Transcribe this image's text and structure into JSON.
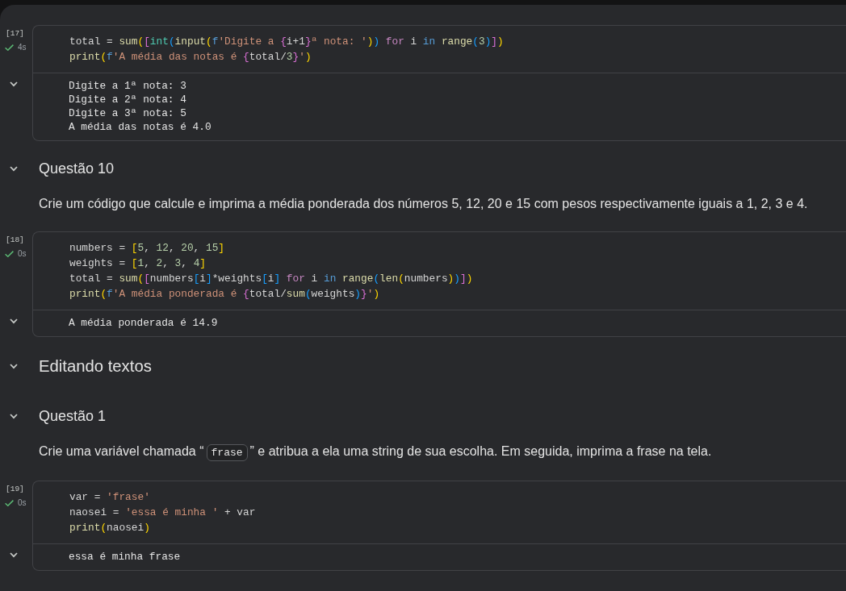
{
  "notebook": {
    "blocks": [
      {
        "kind": "code_cell",
        "execution_count": "[17]",
        "succeeded": true,
        "duration": "4s",
        "code": [
          {
            "tokens": [
              {
                "kind": "plain",
                "text": "total = "
              },
              {
                "kind": "function",
                "text": "sum"
              },
              {
                "kind": "bracket1",
                "text": "("
              },
              {
                "kind": "bracket2",
                "text": "["
              },
              {
                "kind": "builtin_type",
                "text": "int"
              },
              {
                "kind": "bracket3",
                "text": "("
              },
              {
                "kind": "function",
                "text": "input"
              },
              {
                "kind": "bracket1",
                "text": "("
              },
              {
                "kind": "keyword",
                "text": "f"
              },
              {
                "kind": "string",
                "text": "'Digite a "
              },
              {
                "kind": "bracket2",
                "text": "{"
              },
              {
                "kind": "plain",
                "text": "i+1"
              },
              {
                "kind": "bracket2",
                "text": "}"
              },
              {
                "kind": "string",
                "text": "ª nota: '"
              },
              {
                "kind": "bracket1",
                "text": ")"
              },
              {
                "kind": "bracket3",
                "text": ")"
              },
              {
                "kind": "control",
                "text": " for"
              },
              {
                "kind": "plain",
                "text": " i "
              },
              {
                "kind": "keyword",
                "text": "in"
              },
              {
                "kind": "function",
                "text": " range"
              },
              {
                "kind": "bracket3",
                "text": "("
              },
              {
                "kind": "number",
                "text": "3"
              },
              {
                "kind": "bracket3",
                "text": ")"
              },
              {
                "kind": "bracket2",
                "text": "]"
              },
              {
                "kind": "bracket1",
                "text": ")"
              }
            ]
          },
          {
            "tokens": [
              {
                "kind": "function",
                "text": "print"
              },
              {
                "kind": "bracket1",
                "text": "("
              },
              {
                "kind": "keyword",
                "text": "f"
              },
              {
                "kind": "string",
                "text": "'A média das notas é "
              },
              {
                "kind": "bracket2",
                "text": "{"
              },
              {
                "kind": "plain",
                "text": "total/"
              },
              {
                "kind": "number",
                "text": "3"
              },
              {
                "kind": "bracket2",
                "text": "}"
              },
              {
                "kind": "string",
                "text": "'"
              },
              {
                "kind": "bracket1",
                "text": ")"
              }
            ]
          }
        ],
        "output": {
          "expanded": true,
          "lines": [
            "Digite a 1ª nota: 3",
            "Digite a 2ª nota: 4",
            "Digite a 3ª nota: 5",
            "A média das notas é 4.0"
          ]
        }
      },
      {
        "kind": "text_cell",
        "heading": {
          "kind": "h3",
          "text": "Questão 10",
          "expanded": true
        },
        "paragraph": [
          {
            "kind": "text",
            "text": "Crie um código que calcule e imprima a média ponderada dos números 5, 12, 20 e 15 com pesos respectivamente iguais a 1, 2, 3 e 4."
          }
        ]
      },
      {
        "kind": "code_cell",
        "execution_count": "[18]",
        "succeeded": true,
        "duration": "0s",
        "code": [
          {
            "tokens": [
              {
                "kind": "plain",
                "text": "numbers = "
              },
              {
                "kind": "bracket1",
                "text": "["
              },
              {
                "kind": "number",
                "text": "5"
              },
              {
                "kind": "plain",
                "text": ", "
              },
              {
                "kind": "number",
                "text": "12"
              },
              {
                "kind": "plain",
                "text": ", "
              },
              {
                "kind": "number",
                "text": "20"
              },
              {
                "kind": "plain",
                "text": ", "
              },
              {
                "kind": "number",
                "text": "15"
              },
              {
                "kind": "bracket1",
                "text": "]"
              }
            ]
          },
          {
            "tokens": [
              {
                "kind": "plain",
                "text": "weights = "
              },
              {
                "kind": "bracket1",
                "text": "["
              },
              {
                "kind": "number",
                "text": "1"
              },
              {
                "kind": "plain",
                "text": ", "
              },
              {
                "kind": "number",
                "text": "2"
              },
              {
                "kind": "plain",
                "text": ", "
              },
              {
                "kind": "number",
                "text": "3"
              },
              {
                "kind": "plain",
                "text": ", "
              },
              {
                "kind": "number",
                "text": "4"
              },
              {
                "kind": "bracket1",
                "text": "]"
              }
            ]
          },
          {
            "tokens": [
              {
                "kind": "plain",
                "text": "total = "
              },
              {
                "kind": "function",
                "text": "sum"
              },
              {
                "kind": "bracket1",
                "text": "("
              },
              {
                "kind": "bracket2",
                "text": "["
              },
              {
                "kind": "plain",
                "text": "numbers"
              },
              {
                "kind": "bracket3",
                "text": "["
              },
              {
                "kind": "plain",
                "text": "i"
              },
              {
                "kind": "bracket3",
                "text": "]"
              },
              {
                "kind": "plain",
                "text": "*weights"
              },
              {
                "kind": "bracket3",
                "text": "["
              },
              {
                "kind": "plain",
                "text": "i"
              },
              {
                "kind": "bracket3",
                "text": "]"
              },
              {
                "kind": "control",
                "text": " for"
              },
              {
                "kind": "plain",
                "text": " i "
              },
              {
                "kind": "keyword",
                "text": "in"
              },
              {
                "kind": "function",
                "text": " range"
              },
              {
                "kind": "bracket3",
                "text": "("
              },
              {
                "kind": "function",
                "text": "len"
              },
              {
                "kind": "bracket1",
                "text": "("
              },
              {
                "kind": "plain",
                "text": "numbers"
              },
              {
                "kind": "bracket1",
                "text": ")"
              },
              {
                "kind": "bracket3",
                "text": ")"
              },
              {
                "kind": "bracket2",
                "text": "]"
              },
              {
                "kind": "bracket1",
                "text": ")"
              }
            ]
          },
          {
            "tokens": [
              {
                "kind": "function",
                "text": "print"
              },
              {
                "kind": "bracket1",
                "text": "("
              },
              {
                "kind": "keyword",
                "text": "f"
              },
              {
                "kind": "string",
                "text": "'A média ponderada é "
              },
              {
                "kind": "bracket2",
                "text": "{"
              },
              {
                "kind": "plain",
                "text": "total/"
              },
              {
                "kind": "function",
                "text": "sum"
              },
              {
                "kind": "bracket3",
                "text": "("
              },
              {
                "kind": "plain",
                "text": "weights"
              },
              {
                "kind": "bracket3",
                "text": ")"
              },
              {
                "kind": "bracket2",
                "text": "}"
              },
              {
                "kind": "string",
                "text": "'"
              },
              {
                "kind": "bracket1",
                "text": ")"
              }
            ]
          }
        ],
        "output": {
          "expanded": true,
          "lines": [
            "A média ponderada é 14.9"
          ]
        }
      },
      {
        "kind": "text_cell",
        "heading": {
          "kind": "h2",
          "text": "Editando textos",
          "expanded": true
        }
      },
      {
        "kind": "text_cell",
        "heading": {
          "kind": "h3",
          "text": "Questão 1",
          "expanded": true
        },
        "paragraph": [
          {
            "kind": "text",
            "text": "Crie uma variável chamada “"
          },
          {
            "kind": "code",
            "text": "frase"
          },
          {
            "kind": "text",
            "text": "” e atribua a ela uma string de sua escolha. Em seguida, imprima a frase na tela."
          }
        ]
      },
      {
        "kind": "code_cell",
        "execution_count": "[19]",
        "succeeded": true,
        "duration": "0s",
        "code": [
          {
            "tokens": [
              {
                "kind": "plain",
                "text": "var = "
              },
              {
                "kind": "string",
                "text": "'frase'"
              }
            ]
          },
          {
            "tokens": [
              {
                "kind": "plain",
                "text": "naosei = "
              },
              {
                "kind": "string",
                "text": "'essa é minha '"
              },
              {
                "kind": "plain",
                "text": " + var"
              }
            ]
          },
          {
            "tokens": [
              {
                "kind": "function",
                "text": "print"
              },
              {
                "kind": "bracket1",
                "text": "("
              },
              {
                "kind": "plain",
                "text": "naosei"
              },
              {
                "kind": "bracket1",
                "text": ")"
              }
            ]
          }
        ],
        "output": {
          "expanded": true,
          "lines": [
            "essa é minha frase"
          ]
        }
      }
    ]
  }
}
